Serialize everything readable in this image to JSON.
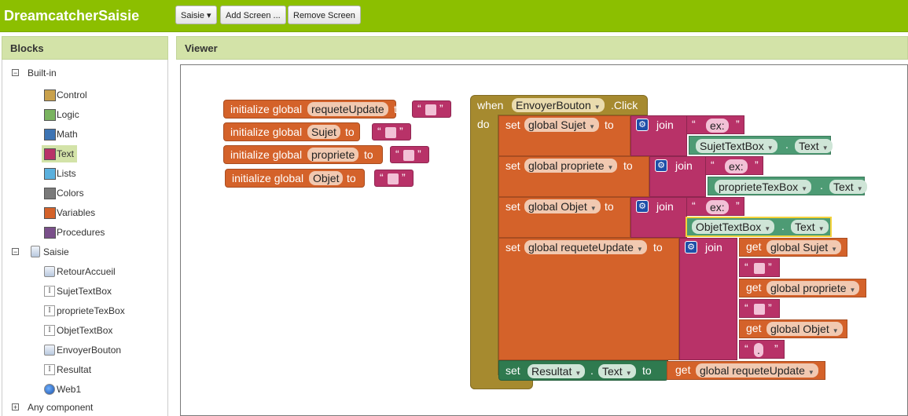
{
  "app": {
    "title": "DreamcatcherSaisie"
  },
  "toolbar": {
    "screen_label": "Saisie ▾",
    "add_screen": "Add Screen ...",
    "remove_screen": "Remove Screen"
  },
  "panels": {
    "blocks_title": "Blocks",
    "viewer_title": "Viewer"
  },
  "tree": {
    "builtin": "Built-in",
    "builtin_items": [
      {
        "label": "Control",
        "color": "#c9a14c"
      },
      {
        "label": "Logic",
        "color": "#79b35f"
      },
      {
        "label": "Math",
        "color": "#3d74b4"
      },
      {
        "label": "Text",
        "color": "#b83268"
      },
      {
        "label": "Lists",
        "color": "#5bb0dd"
      },
      {
        "label": "Colors",
        "color": "#7a7a7a"
      },
      {
        "label": "Variables",
        "color": "#d4622a"
      },
      {
        "label": "Procedures",
        "color": "#7a4f8a"
      }
    ],
    "screen": "Saisie",
    "components": [
      "RetourAccueil",
      "SujetTextBox",
      "proprieteTexBox",
      "ObjetTextBox",
      "EnvoyerBouton",
      "Resultat",
      "Web1"
    ],
    "any": "Any component"
  },
  "blocks": {
    "init_label": "initialize global",
    "to": "to",
    "var_requete": "requeteUpdate",
    "var_sujet": "Sujet",
    "var_propriete": "propriete",
    "var_objet": "Objet",
    "when": "when",
    "event_component": "EnvoyerBouton",
    "event_name": ".Click",
    "do": "do",
    "set": "set",
    "join": "join",
    "get": "get",
    "global_sujet": "global Sujet",
    "global_propriete": "global propriete",
    "global_objet": "global Objet",
    "global_requete": "global requeteUpdate",
    "ex": "ex:",
    "sujet_tb": "SujetTextBox",
    "propriete_tb": "proprieteTexBox",
    "objet_tb": "ObjetTextBox",
    "dot": ".",
    "text_prop": "Text",
    "resultat": "Resultat",
    "quote_open": "“",
    "quote_close": "”",
    "period_str": "."
  }
}
